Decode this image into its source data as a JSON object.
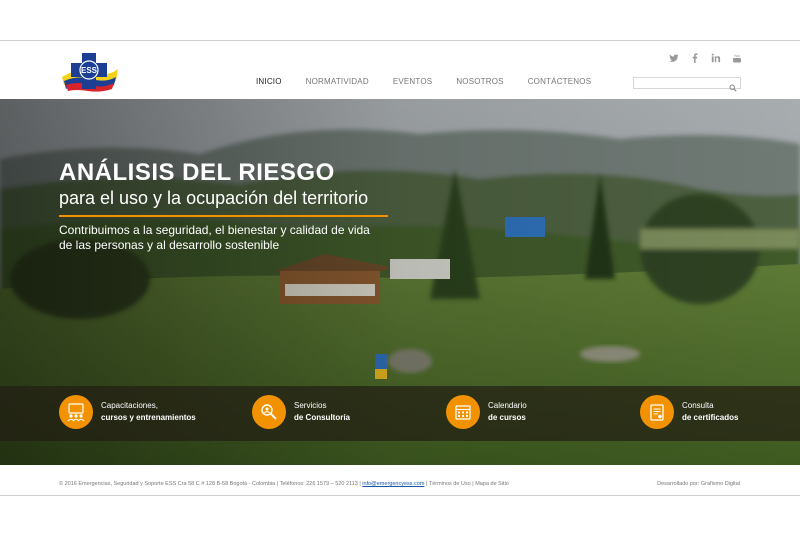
{
  "nav": {
    "items": [
      "INICIO",
      "NORMATIVIDAD",
      "EVENTOS",
      "NOSOTROS",
      "CONTÁCTENOS"
    ],
    "active": "INICIO"
  },
  "logo": {
    "text": "ESS"
  },
  "social": {
    "icons": [
      "twitter-icon",
      "facebook-icon",
      "linkedin-icon",
      "youtube-icon"
    ],
    "youtube_label": "You"
  },
  "search": {
    "placeholder": "",
    "value": ""
  },
  "hero": {
    "title": "ANÁLISIS DEL RIESGO",
    "subtitle": "para el uso y la ocupación del territorio",
    "text": "Contribuimos a la seguridad, el bienestar y calidad de vida de las personas y al desarrollo sostenible"
  },
  "services": [
    {
      "line1": "Capacitaciones,",
      "line2": "cursos y entrenamientos",
      "icon": "training-icon"
    },
    {
      "line1": "Servicios",
      "line2": "de Consultoría",
      "icon": "consulting-icon"
    },
    {
      "line1": "Calendario",
      "line2": "de cursos",
      "icon": "calendar-icon"
    },
    {
      "line1": "Consulta",
      "line2": "de certificados",
      "icon": "certificate-icon"
    }
  ],
  "footer": {
    "copyright": "© 2016 Emergencias, Seguridad y Soporte ESS  Cra 58 C # 128 B-58 Bogotá - Colombia  |  Teléfonos: 226 1579 – 520 2113  |",
    "email": "info@emergencyess.com",
    "terms": "Términos de Uso",
    "sitemap": "Mapa de Sitio",
    "developer": "Desarrollado por: Grafismo Digital"
  },
  "colors": {
    "accent": "#f39200",
    "link": "#1a55a8"
  }
}
